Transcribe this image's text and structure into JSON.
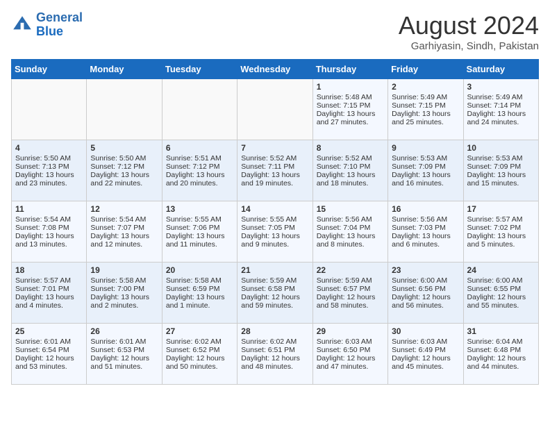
{
  "header": {
    "logo_line1": "General",
    "logo_line2": "Blue",
    "month": "August 2024",
    "location": "Garhiyasin, Sindh, Pakistan"
  },
  "days_of_week": [
    "Sunday",
    "Monday",
    "Tuesday",
    "Wednesday",
    "Thursday",
    "Friday",
    "Saturday"
  ],
  "weeks": [
    [
      {
        "day": "",
        "lines": []
      },
      {
        "day": "",
        "lines": []
      },
      {
        "day": "",
        "lines": []
      },
      {
        "day": "",
        "lines": []
      },
      {
        "day": "1",
        "lines": [
          "Sunrise: 5:48 AM",
          "Sunset: 7:15 PM",
          "Daylight: 13 hours",
          "and 27 minutes."
        ]
      },
      {
        "day": "2",
        "lines": [
          "Sunrise: 5:49 AM",
          "Sunset: 7:15 PM",
          "Daylight: 13 hours",
          "and 25 minutes."
        ]
      },
      {
        "day": "3",
        "lines": [
          "Sunrise: 5:49 AM",
          "Sunset: 7:14 PM",
          "Daylight: 13 hours",
          "and 24 minutes."
        ]
      }
    ],
    [
      {
        "day": "4",
        "lines": [
          "Sunrise: 5:50 AM",
          "Sunset: 7:13 PM",
          "Daylight: 13 hours",
          "and 23 minutes."
        ]
      },
      {
        "day": "5",
        "lines": [
          "Sunrise: 5:50 AM",
          "Sunset: 7:12 PM",
          "Daylight: 13 hours",
          "and 22 minutes."
        ]
      },
      {
        "day": "6",
        "lines": [
          "Sunrise: 5:51 AM",
          "Sunset: 7:12 PM",
          "Daylight: 13 hours",
          "and 20 minutes."
        ]
      },
      {
        "day": "7",
        "lines": [
          "Sunrise: 5:52 AM",
          "Sunset: 7:11 PM",
          "Daylight: 13 hours",
          "and 19 minutes."
        ]
      },
      {
        "day": "8",
        "lines": [
          "Sunrise: 5:52 AM",
          "Sunset: 7:10 PM",
          "Daylight: 13 hours",
          "and 18 minutes."
        ]
      },
      {
        "day": "9",
        "lines": [
          "Sunrise: 5:53 AM",
          "Sunset: 7:09 PM",
          "Daylight: 13 hours",
          "and 16 minutes."
        ]
      },
      {
        "day": "10",
        "lines": [
          "Sunrise: 5:53 AM",
          "Sunset: 7:09 PM",
          "Daylight: 13 hours",
          "and 15 minutes."
        ]
      }
    ],
    [
      {
        "day": "11",
        "lines": [
          "Sunrise: 5:54 AM",
          "Sunset: 7:08 PM",
          "Daylight: 13 hours",
          "and 13 minutes."
        ]
      },
      {
        "day": "12",
        "lines": [
          "Sunrise: 5:54 AM",
          "Sunset: 7:07 PM",
          "Daylight: 13 hours",
          "and 12 minutes."
        ]
      },
      {
        "day": "13",
        "lines": [
          "Sunrise: 5:55 AM",
          "Sunset: 7:06 PM",
          "Daylight: 13 hours",
          "and 11 minutes."
        ]
      },
      {
        "day": "14",
        "lines": [
          "Sunrise: 5:55 AM",
          "Sunset: 7:05 PM",
          "Daylight: 13 hours",
          "and 9 minutes."
        ]
      },
      {
        "day": "15",
        "lines": [
          "Sunrise: 5:56 AM",
          "Sunset: 7:04 PM",
          "Daylight: 13 hours",
          "and 8 minutes."
        ]
      },
      {
        "day": "16",
        "lines": [
          "Sunrise: 5:56 AM",
          "Sunset: 7:03 PM",
          "Daylight: 13 hours",
          "and 6 minutes."
        ]
      },
      {
        "day": "17",
        "lines": [
          "Sunrise: 5:57 AM",
          "Sunset: 7:02 PM",
          "Daylight: 13 hours",
          "and 5 minutes."
        ]
      }
    ],
    [
      {
        "day": "18",
        "lines": [
          "Sunrise: 5:57 AM",
          "Sunset: 7:01 PM",
          "Daylight: 13 hours",
          "and 4 minutes."
        ]
      },
      {
        "day": "19",
        "lines": [
          "Sunrise: 5:58 AM",
          "Sunset: 7:00 PM",
          "Daylight: 13 hours",
          "and 2 minutes."
        ]
      },
      {
        "day": "20",
        "lines": [
          "Sunrise: 5:58 AM",
          "Sunset: 6:59 PM",
          "Daylight: 13 hours",
          "and 1 minute."
        ]
      },
      {
        "day": "21",
        "lines": [
          "Sunrise: 5:59 AM",
          "Sunset: 6:58 PM",
          "Daylight: 12 hours",
          "and 59 minutes."
        ]
      },
      {
        "day": "22",
        "lines": [
          "Sunrise: 5:59 AM",
          "Sunset: 6:57 PM",
          "Daylight: 12 hours",
          "and 58 minutes."
        ]
      },
      {
        "day": "23",
        "lines": [
          "Sunrise: 6:00 AM",
          "Sunset: 6:56 PM",
          "Daylight: 12 hours",
          "and 56 minutes."
        ]
      },
      {
        "day": "24",
        "lines": [
          "Sunrise: 6:00 AM",
          "Sunset: 6:55 PM",
          "Daylight: 12 hours",
          "and 55 minutes."
        ]
      }
    ],
    [
      {
        "day": "25",
        "lines": [
          "Sunrise: 6:01 AM",
          "Sunset: 6:54 PM",
          "Daylight: 12 hours",
          "and 53 minutes."
        ]
      },
      {
        "day": "26",
        "lines": [
          "Sunrise: 6:01 AM",
          "Sunset: 6:53 PM",
          "Daylight: 12 hours",
          "and 51 minutes."
        ]
      },
      {
        "day": "27",
        "lines": [
          "Sunrise: 6:02 AM",
          "Sunset: 6:52 PM",
          "Daylight: 12 hours",
          "and 50 minutes."
        ]
      },
      {
        "day": "28",
        "lines": [
          "Sunrise: 6:02 AM",
          "Sunset: 6:51 PM",
          "Daylight: 12 hours",
          "and 48 minutes."
        ]
      },
      {
        "day": "29",
        "lines": [
          "Sunrise: 6:03 AM",
          "Sunset: 6:50 PM",
          "Daylight: 12 hours",
          "and 47 minutes."
        ]
      },
      {
        "day": "30",
        "lines": [
          "Sunrise: 6:03 AM",
          "Sunset: 6:49 PM",
          "Daylight: 12 hours",
          "and 45 minutes."
        ]
      },
      {
        "day": "31",
        "lines": [
          "Sunrise: 6:04 AM",
          "Sunset: 6:48 PM",
          "Daylight: 12 hours",
          "and 44 minutes."
        ]
      }
    ]
  ]
}
